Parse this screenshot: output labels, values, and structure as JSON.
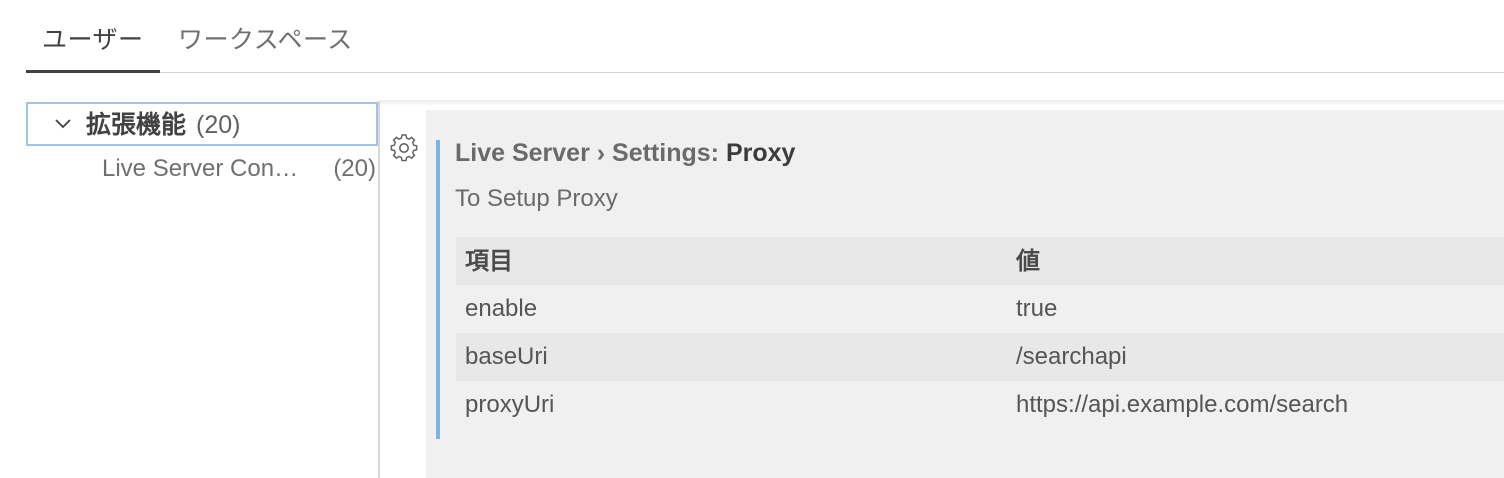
{
  "tabs": {
    "user": "ユーザー",
    "workspace": "ワークスペース"
  },
  "tree": {
    "group_label": "拡張機能",
    "group_count": "(20)",
    "item_label": "Live Server Con…",
    "item_count": "(20)"
  },
  "setting": {
    "title_prefix": "Live Server › Settings: ",
    "title_key": "Proxy",
    "description": "To Setup Proxy",
    "columns": {
      "item": "項目",
      "value": "値"
    },
    "rows": [
      {
        "item": "enable",
        "value": "true"
      },
      {
        "item": "baseUri",
        "value": "/searchapi"
      },
      {
        "item": "proxyUri",
        "value": "https://api.example.com/search"
      }
    ]
  },
  "icons": {
    "chevron": "chevron-down-icon",
    "gear": "gear-icon"
  },
  "colors": {
    "modified_indicator": "#7cb3e6",
    "focus_border": "#9fc3e9",
    "panel_background": "#f0f0f0",
    "active_tab_underline": "#424242"
  }
}
